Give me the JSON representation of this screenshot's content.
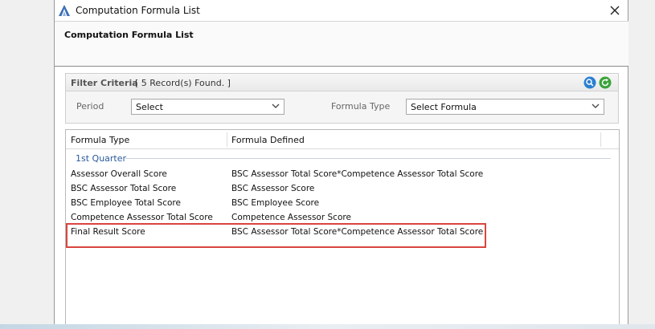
{
  "window": {
    "title": "Computation Formula List",
    "header_title": "Computation Formula List",
    "icons": {
      "app": "app-logo-icon",
      "close": "close-icon"
    }
  },
  "filter": {
    "label": "Filter Criteria",
    "records_found": "[ 5 Record(s) Found. ]",
    "period_label": "Period",
    "period_value": "Select",
    "formula_type_label": "Formula Type",
    "formula_type_value": "Select Formula",
    "icons": {
      "search": "search-icon",
      "refresh": "refresh-icon",
      "dropdown": "chevron-down-icon"
    }
  },
  "grid": {
    "columns": [
      "Formula Type",
      "Formula Defined"
    ],
    "group": "1st Quarter",
    "rows": [
      {
        "formula_type": "Assessor Overall Score",
        "formula_defined": "BSC Assessor Total Score*Competence Assessor Total Score"
      },
      {
        "formula_type": "BSC Assessor Total Score",
        "formula_defined": "BSC Assessor Score"
      },
      {
        "formula_type": "BSC Employee Total Score",
        "formula_defined": "BSC Employee Score"
      },
      {
        "formula_type": "Competence Assessor Total Score",
        "formula_defined": "Competence Assessor Score"
      },
      {
        "formula_type": "Final Result Score",
        "formula_defined": "BSC Assessor Total Score*Competence Assessor Total Score"
      }
    ]
  },
  "colors": {
    "highlight": "#d9453f",
    "group_text": "#2a5a9a",
    "search_icon": "#2b7fd1",
    "refresh_icon": "#3aa33a"
  }
}
